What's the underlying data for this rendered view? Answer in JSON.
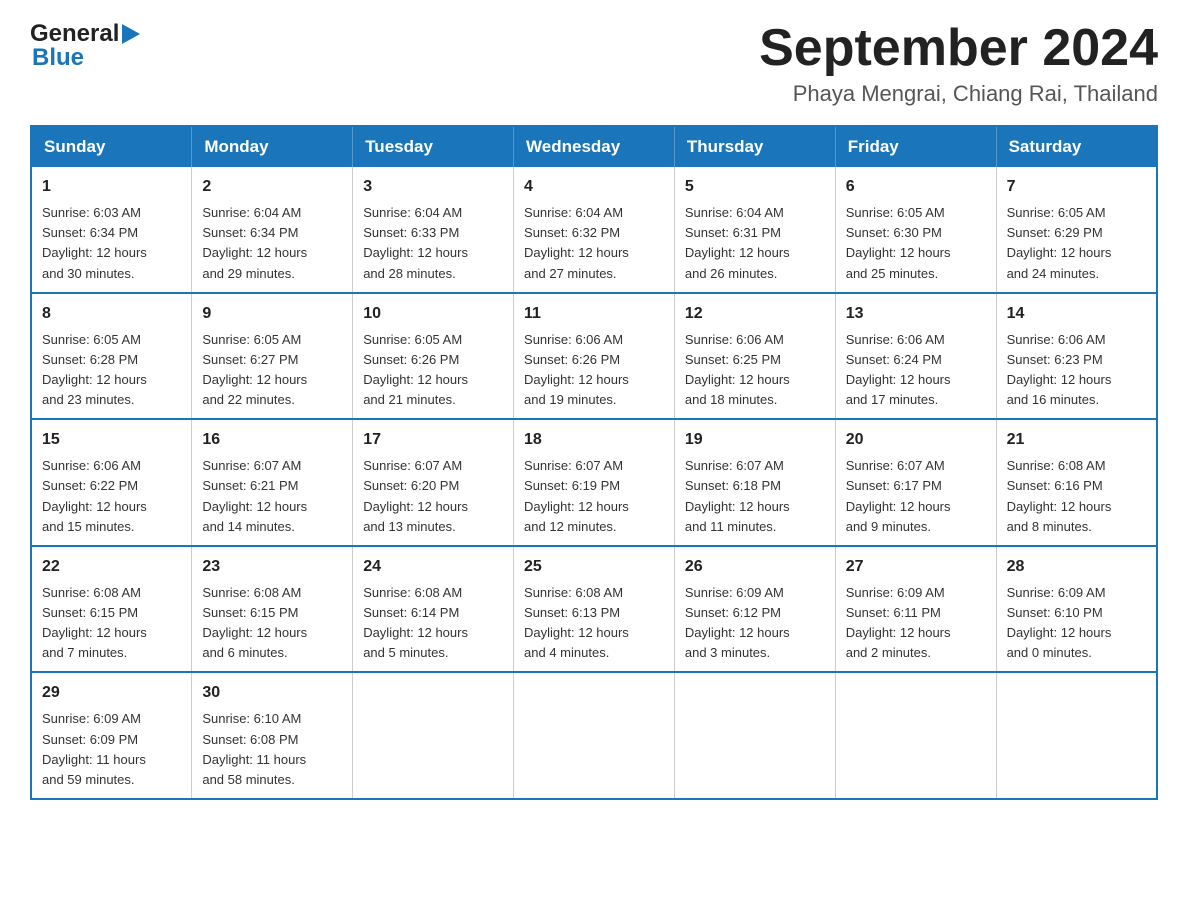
{
  "header": {
    "logo_general": "General",
    "logo_blue": "Blue",
    "month_title": "September 2024",
    "location": "Phaya Mengrai, Chiang Rai, Thailand"
  },
  "days_of_week": [
    "Sunday",
    "Monday",
    "Tuesday",
    "Wednesday",
    "Thursday",
    "Friday",
    "Saturday"
  ],
  "weeks": [
    [
      {
        "day": "1",
        "sunrise": "6:03 AM",
        "sunset": "6:34 PM",
        "daylight": "12 hours and 30 minutes."
      },
      {
        "day": "2",
        "sunrise": "6:04 AM",
        "sunset": "6:34 PM",
        "daylight": "12 hours and 29 minutes."
      },
      {
        "day": "3",
        "sunrise": "6:04 AM",
        "sunset": "6:33 PM",
        "daylight": "12 hours and 28 minutes."
      },
      {
        "day": "4",
        "sunrise": "6:04 AM",
        "sunset": "6:32 PM",
        "daylight": "12 hours and 27 minutes."
      },
      {
        "day": "5",
        "sunrise": "6:04 AM",
        "sunset": "6:31 PM",
        "daylight": "12 hours and 26 minutes."
      },
      {
        "day": "6",
        "sunrise": "6:05 AM",
        "sunset": "6:30 PM",
        "daylight": "12 hours and 25 minutes."
      },
      {
        "day": "7",
        "sunrise": "6:05 AM",
        "sunset": "6:29 PM",
        "daylight": "12 hours and 24 minutes."
      }
    ],
    [
      {
        "day": "8",
        "sunrise": "6:05 AM",
        "sunset": "6:28 PM",
        "daylight": "12 hours and 23 minutes."
      },
      {
        "day": "9",
        "sunrise": "6:05 AM",
        "sunset": "6:27 PM",
        "daylight": "12 hours and 22 minutes."
      },
      {
        "day": "10",
        "sunrise": "6:05 AM",
        "sunset": "6:26 PM",
        "daylight": "12 hours and 21 minutes."
      },
      {
        "day": "11",
        "sunrise": "6:06 AM",
        "sunset": "6:26 PM",
        "daylight": "12 hours and 19 minutes."
      },
      {
        "day": "12",
        "sunrise": "6:06 AM",
        "sunset": "6:25 PM",
        "daylight": "12 hours and 18 minutes."
      },
      {
        "day": "13",
        "sunrise": "6:06 AM",
        "sunset": "6:24 PM",
        "daylight": "12 hours and 17 minutes."
      },
      {
        "day": "14",
        "sunrise": "6:06 AM",
        "sunset": "6:23 PM",
        "daylight": "12 hours and 16 minutes."
      }
    ],
    [
      {
        "day": "15",
        "sunrise": "6:06 AM",
        "sunset": "6:22 PM",
        "daylight": "12 hours and 15 minutes."
      },
      {
        "day": "16",
        "sunrise": "6:07 AM",
        "sunset": "6:21 PM",
        "daylight": "12 hours and 14 minutes."
      },
      {
        "day": "17",
        "sunrise": "6:07 AM",
        "sunset": "6:20 PM",
        "daylight": "12 hours and 13 minutes."
      },
      {
        "day": "18",
        "sunrise": "6:07 AM",
        "sunset": "6:19 PM",
        "daylight": "12 hours and 12 minutes."
      },
      {
        "day": "19",
        "sunrise": "6:07 AM",
        "sunset": "6:18 PM",
        "daylight": "12 hours and 11 minutes."
      },
      {
        "day": "20",
        "sunrise": "6:07 AM",
        "sunset": "6:17 PM",
        "daylight": "12 hours and 9 minutes."
      },
      {
        "day": "21",
        "sunrise": "6:08 AM",
        "sunset": "6:16 PM",
        "daylight": "12 hours and 8 minutes."
      }
    ],
    [
      {
        "day": "22",
        "sunrise": "6:08 AM",
        "sunset": "6:15 PM",
        "daylight": "12 hours and 7 minutes."
      },
      {
        "day": "23",
        "sunrise": "6:08 AM",
        "sunset": "6:15 PM",
        "daylight": "12 hours and 6 minutes."
      },
      {
        "day": "24",
        "sunrise": "6:08 AM",
        "sunset": "6:14 PM",
        "daylight": "12 hours and 5 minutes."
      },
      {
        "day": "25",
        "sunrise": "6:08 AM",
        "sunset": "6:13 PM",
        "daylight": "12 hours and 4 minutes."
      },
      {
        "day": "26",
        "sunrise": "6:09 AM",
        "sunset": "6:12 PM",
        "daylight": "12 hours and 3 minutes."
      },
      {
        "day": "27",
        "sunrise": "6:09 AM",
        "sunset": "6:11 PM",
        "daylight": "12 hours and 2 minutes."
      },
      {
        "day": "28",
        "sunrise": "6:09 AM",
        "sunset": "6:10 PM",
        "daylight": "12 hours and 0 minutes."
      }
    ],
    [
      {
        "day": "29",
        "sunrise": "6:09 AM",
        "sunset": "6:09 PM",
        "daylight": "11 hours and 59 minutes."
      },
      {
        "day": "30",
        "sunrise": "6:10 AM",
        "sunset": "6:08 PM",
        "daylight": "11 hours and 58 minutes."
      },
      null,
      null,
      null,
      null,
      null
    ]
  ],
  "labels": {
    "sunrise": "Sunrise:",
    "sunset": "Sunset:",
    "daylight": "Daylight:"
  }
}
